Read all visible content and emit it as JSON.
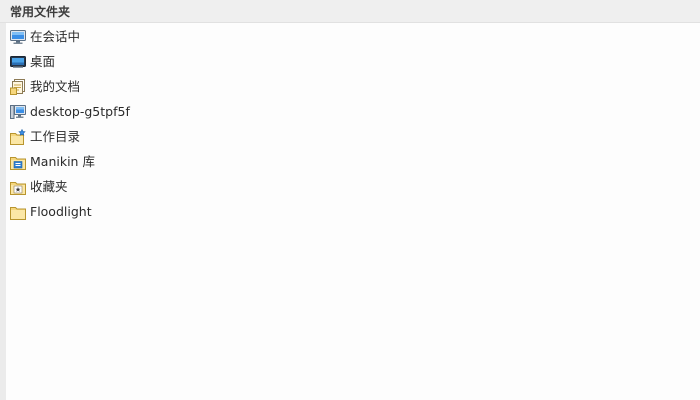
{
  "header": {
    "title": "常用文件夹"
  },
  "folders": [
    {
      "label": "在会话中",
      "icon": "monitor-icon"
    },
    {
      "label": "桌面",
      "icon": "desktop-icon"
    },
    {
      "label": "我的文档",
      "icon": "documents-icon"
    },
    {
      "label": "desktop-g5tpf5f",
      "icon": "computer-icon"
    },
    {
      "label": "工作目录",
      "icon": "working-directory-icon"
    },
    {
      "label": "Manikin 库",
      "icon": "library-icon"
    },
    {
      "label": "收藏夹",
      "icon": "favorites-icon"
    },
    {
      "label": "Floodlight",
      "icon": "folder-icon"
    }
  ],
  "colors": {
    "header_bg": "#efefef",
    "folder_yellow": "#f6d77e",
    "monitor_blue": "#3a8ee6"
  }
}
